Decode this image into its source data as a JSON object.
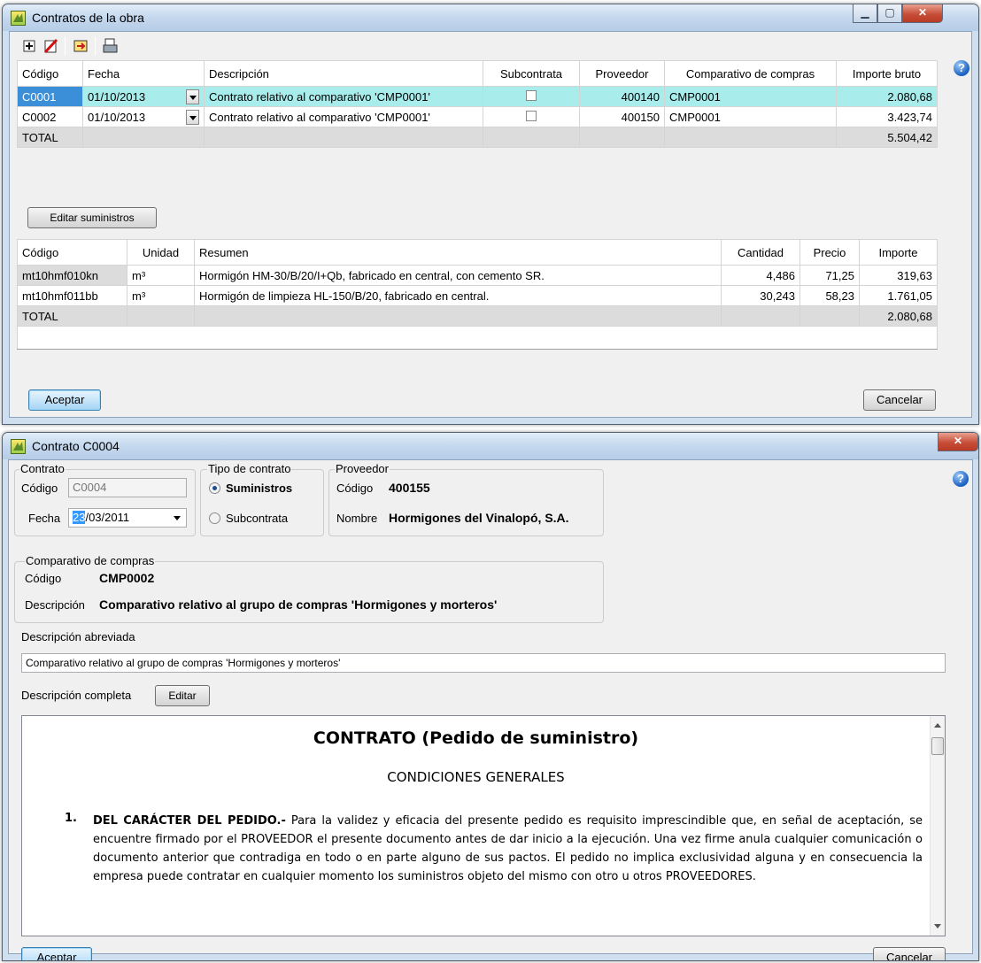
{
  "win1": {
    "title": "Contratos de la obra",
    "contracts": {
      "columns": [
        "Código",
        "Fecha",
        "Descripción",
        "Subcontrata",
        "Proveedor",
        "Comparativo de compras",
        "Importe bruto"
      ],
      "rows": [
        {
          "code": "C0001",
          "date": "01/10/2013",
          "desc": "Contrato relativo al comparativo 'CMP0001'",
          "supplier": "400140",
          "comp": "CMP0001",
          "amount": "2.080,68"
        },
        {
          "code": "C0002",
          "date": "01/10/2013",
          "desc": "Contrato relativo al comparativo 'CMP0001'",
          "supplier": "400150",
          "comp": "CMP0001",
          "amount": "3.423,74"
        }
      ],
      "total_label": "TOTAL",
      "total_amount": "5.504,42"
    },
    "edit_button": "Editar suministros",
    "supplies": {
      "columns": [
        "Código",
        "Unidad",
        "Resumen",
        "Cantidad",
        "Precio",
        "Importe"
      ],
      "rows": [
        {
          "code": "mt10hmf010kn",
          "unit": "m³",
          "summary": "Hormigón HM-30/B/20/I+Qb, fabricado en central, con cemento SR.",
          "qty": "4,486",
          "price": "71,25",
          "amount": "319,63"
        },
        {
          "code": "mt10hmf011bb",
          "unit": "m³",
          "summary": "Hormigón de limpieza HL-150/B/20, fabricado en central.",
          "qty": "30,243",
          "price": "58,23",
          "amount": "1.761,05"
        }
      ],
      "total_label": "TOTAL",
      "total_amount": "2.080,68"
    },
    "accept": "Aceptar",
    "cancel": "Cancelar"
  },
  "win2": {
    "title": "Contrato C0004",
    "contrato_legend": "Contrato",
    "codigo_label": "Código",
    "codigo_value": "C0004",
    "fecha_label": "Fecha",
    "fecha_day": "23",
    "fecha_rest": "/03/2011",
    "tipo_legend": "Tipo de contrato",
    "tipo_suministros": "Suministros",
    "tipo_subcontrata": "Subcontrata",
    "proveedor_legend": "Proveedor",
    "prov_codigo_label": "Código",
    "prov_codigo_value": "400155",
    "prov_nombre_label": "Nombre",
    "prov_nombre_value": "Hormigones del Vinalopó, S.A.",
    "comp_legend": "Comparativo de compras",
    "comp_codigo_label": "Código",
    "comp_codigo_value": "CMP0002",
    "comp_desc_label": "Descripción",
    "comp_desc_value": "Comparativo relativo al grupo de compras 'Hormigones y morteros'",
    "abrev_label": "Descripción abreviada",
    "abrev_value": "Comparativo relativo al grupo de compras 'Hormigones y morteros'",
    "completa_label": "Descripción completa",
    "editar_button": "Editar",
    "doc_title": "CONTRATO (Pedido de suministro)",
    "doc_subtitle": "CONDICIONES GENERALES",
    "doc_item_num": "1.",
    "doc_item_head": "DEL CARÁCTER DEL PEDIDO.-",
    "doc_item_text": "Para la validez y eficacia del presente pedido es requisito imprescindible que, en señal de aceptación, se encuentre firmado por el PROVEEDOR el presente documento antes de dar inicio a la ejecución. Una vez firme anula cualquier comunicación o documento anterior que contradiga en todo o en parte alguno de sus pactos. El pedido no implica exclusividad alguna y en consecuencia la empresa puede contratar en cualquier momento los suministros objeto del mismo con otro u otros PROVEEDORES.",
    "accept": "Aceptar",
    "cancel": "Cancelar"
  }
}
